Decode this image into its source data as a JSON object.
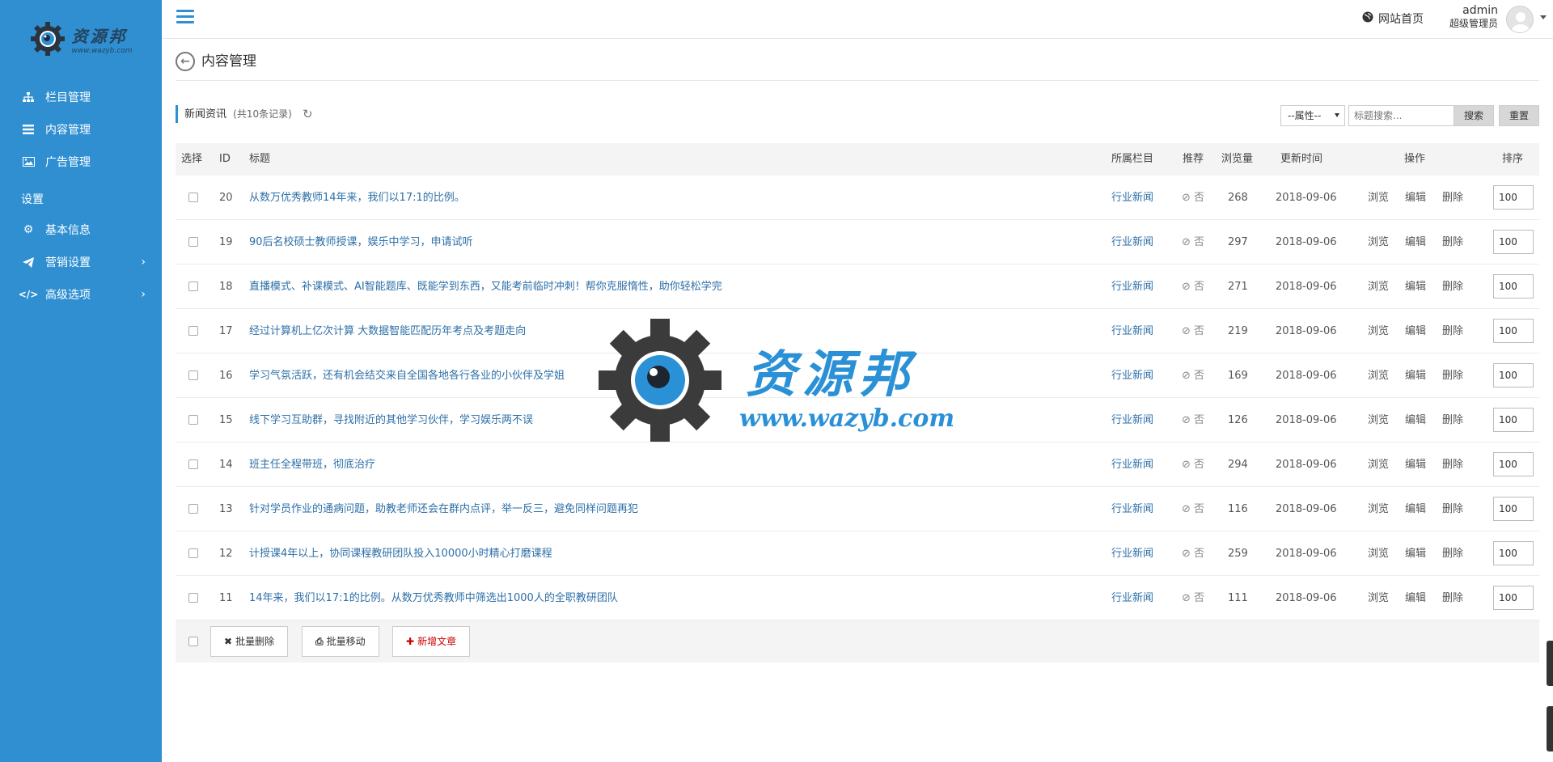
{
  "brand": {
    "name_cn": "资源邦",
    "url": "www.wazyb.com"
  },
  "sidebar": {
    "items": [
      {
        "label": "栏目管理",
        "icon": "sitemap-icon"
      },
      {
        "label": "内容管理",
        "icon": "list-icon"
      },
      {
        "label": "广告管理",
        "icon": "image-icon"
      }
    ],
    "settings_heading": "设置",
    "settings_items": [
      {
        "label": "基本信息",
        "icon": "gear-icon"
      },
      {
        "label": "营销设置",
        "icon": "paper-plane-icon",
        "arrow": "›"
      },
      {
        "label": "高级选项",
        "icon": "code-icon",
        "arrow": "›"
      }
    ]
  },
  "header": {
    "home_link": "网站首页",
    "user_name": "admin",
    "user_role": "超级管理员"
  },
  "page": {
    "title": "内容管理"
  },
  "toolbar": {
    "section": "新闻资讯",
    "count_text": "(共10条记录)",
    "attr_select": "--属性--",
    "search_placeholder": "标题搜索...",
    "search_button": "搜索",
    "reset_button": "重置"
  },
  "table": {
    "headers": {
      "select": "选择",
      "id": "ID",
      "title": "标题",
      "column": "所属栏目",
      "recommend": "推荐",
      "views": "浏览量",
      "updated": "更新时间",
      "actions": "操作",
      "sort": "排序"
    },
    "rows": [
      {
        "id": "20",
        "title": "从数万优秀教师14年来，我们以17:1的比例。",
        "column": "行业新闻",
        "recommend": "⊘ 否",
        "views": "268",
        "date": "2018-09-06",
        "sort": "100"
      },
      {
        "id": "19",
        "title": "90后名校硕士教师授课，娱乐中学习，申请试听",
        "column": "行业新闻",
        "recommend": "⊘ 否",
        "views": "297",
        "date": "2018-09-06",
        "sort": "100"
      },
      {
        "id": "18",
        "title": "直播模式、补课模式、AI智能题库、既能学到东西，又能考前临时冲刺！帮你克服惰性，助你轻松学完",
        "column": "行业新闻",
        "recommend": "⊘ 否",
        "views": "271",
        "date": "2018-09-06",
        "sort": "100"
      },
      {
        "id": "17",
        "title": "经过计算机上亿次计算 大数据智能匹配历年考点及考题走向",
        "column": "行业新闻",
        "recommend": "⊘ 否",
        "views": "219",
        "date": "2018-09-06",
        "sort": "100"
      },
      {
        "id": "16",
        "title": "学习气氛活跃，还有机会结交来自全国各地各行各业的小伙伴及学姐",
        "column": "行业新闻",
        "recommend": "⊘ 否",
        "views": "169",
        "date": "2018-09-06",
        "sort": "100"
      },
      {
        "id": "15",
        "title": "线下学习互助群，寻找附近的其他学习伙伴，学习娱乐两不误",
        "column": "行业新闻",
        "recommend": "⊘ 否",
        "views": "126",
        "date": "2018-09-06",
        "sort": "100"
      },
      {
        "id": "14",
        "title": "班主任全程带班，彻底治疗",
        "column": "行业新闻",
        "recommend": "⊘ 否",
        "views": "294",
        "date": "2018-09-06",
        "sort": "100"
      },
      {
        "id": "13",
        "title": "针对学员作业的通病问题，助教老师还会在群内点评，举一反三，避免同样问题再犯",
        "column": "行业新闻",
        "recommend": "⊘ 否",
        "views": "116",
        "date": "2018-09-06",
        "sort": "100"
      },
      {
        "id": "12",
        "title": "计授课4年以上，协同课程教研团队投入10000小时精心打磨课程",
        "column": "行业新闻",
        "recommend": "⊘ 否",
        "views": "259",
        "date": "2018-09-06",
        "sort": "100"
      },
      {
        "id": "11",
        "title": "14年来，我们以17:1的比例。从数万优秀教师中筛选出1000人的全职教研团队",
        "column": "行业新闻",
        "recommend": "⊘ 否",
        "views": "111",
        "date": "2018-09-06",
        "sort": "100"
      }
    ],
    "row_actions": {
      "browse": "浏览",
      "edit": "编辑",
      "delete": "删除"
    }
  },
  "footer": {
    "batch_delete": "批量删除",
    "batch_move": "批量移动",
    "add_article": "新增文章"
  },
  "colors": {
    "sidebar": "#2f8fd1",
    "link": "#2d6fa7",
    "danger": "#cc0000"
  }
}
